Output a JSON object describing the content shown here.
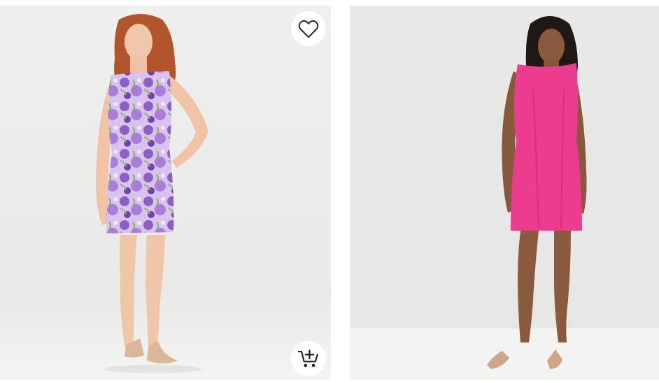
{
  "products": [
    {
      "dress_color": "#b593d8",
      "pattern": "floral",
      "actions": {
        "favorite_icon": "heart-outline-icon",
        "cart_icon": "cart-add-icon"
      }
    },
    {
      "dress_color": "#ec3c8f",
      "pattern": "solid"
    }
  ],
  "colors": {
    "backdrop": "#ebebea",
    "floor": "#f3f3f2",
    "button_bg": "#ffffff",
    "icon": "#222222"
  }
}
